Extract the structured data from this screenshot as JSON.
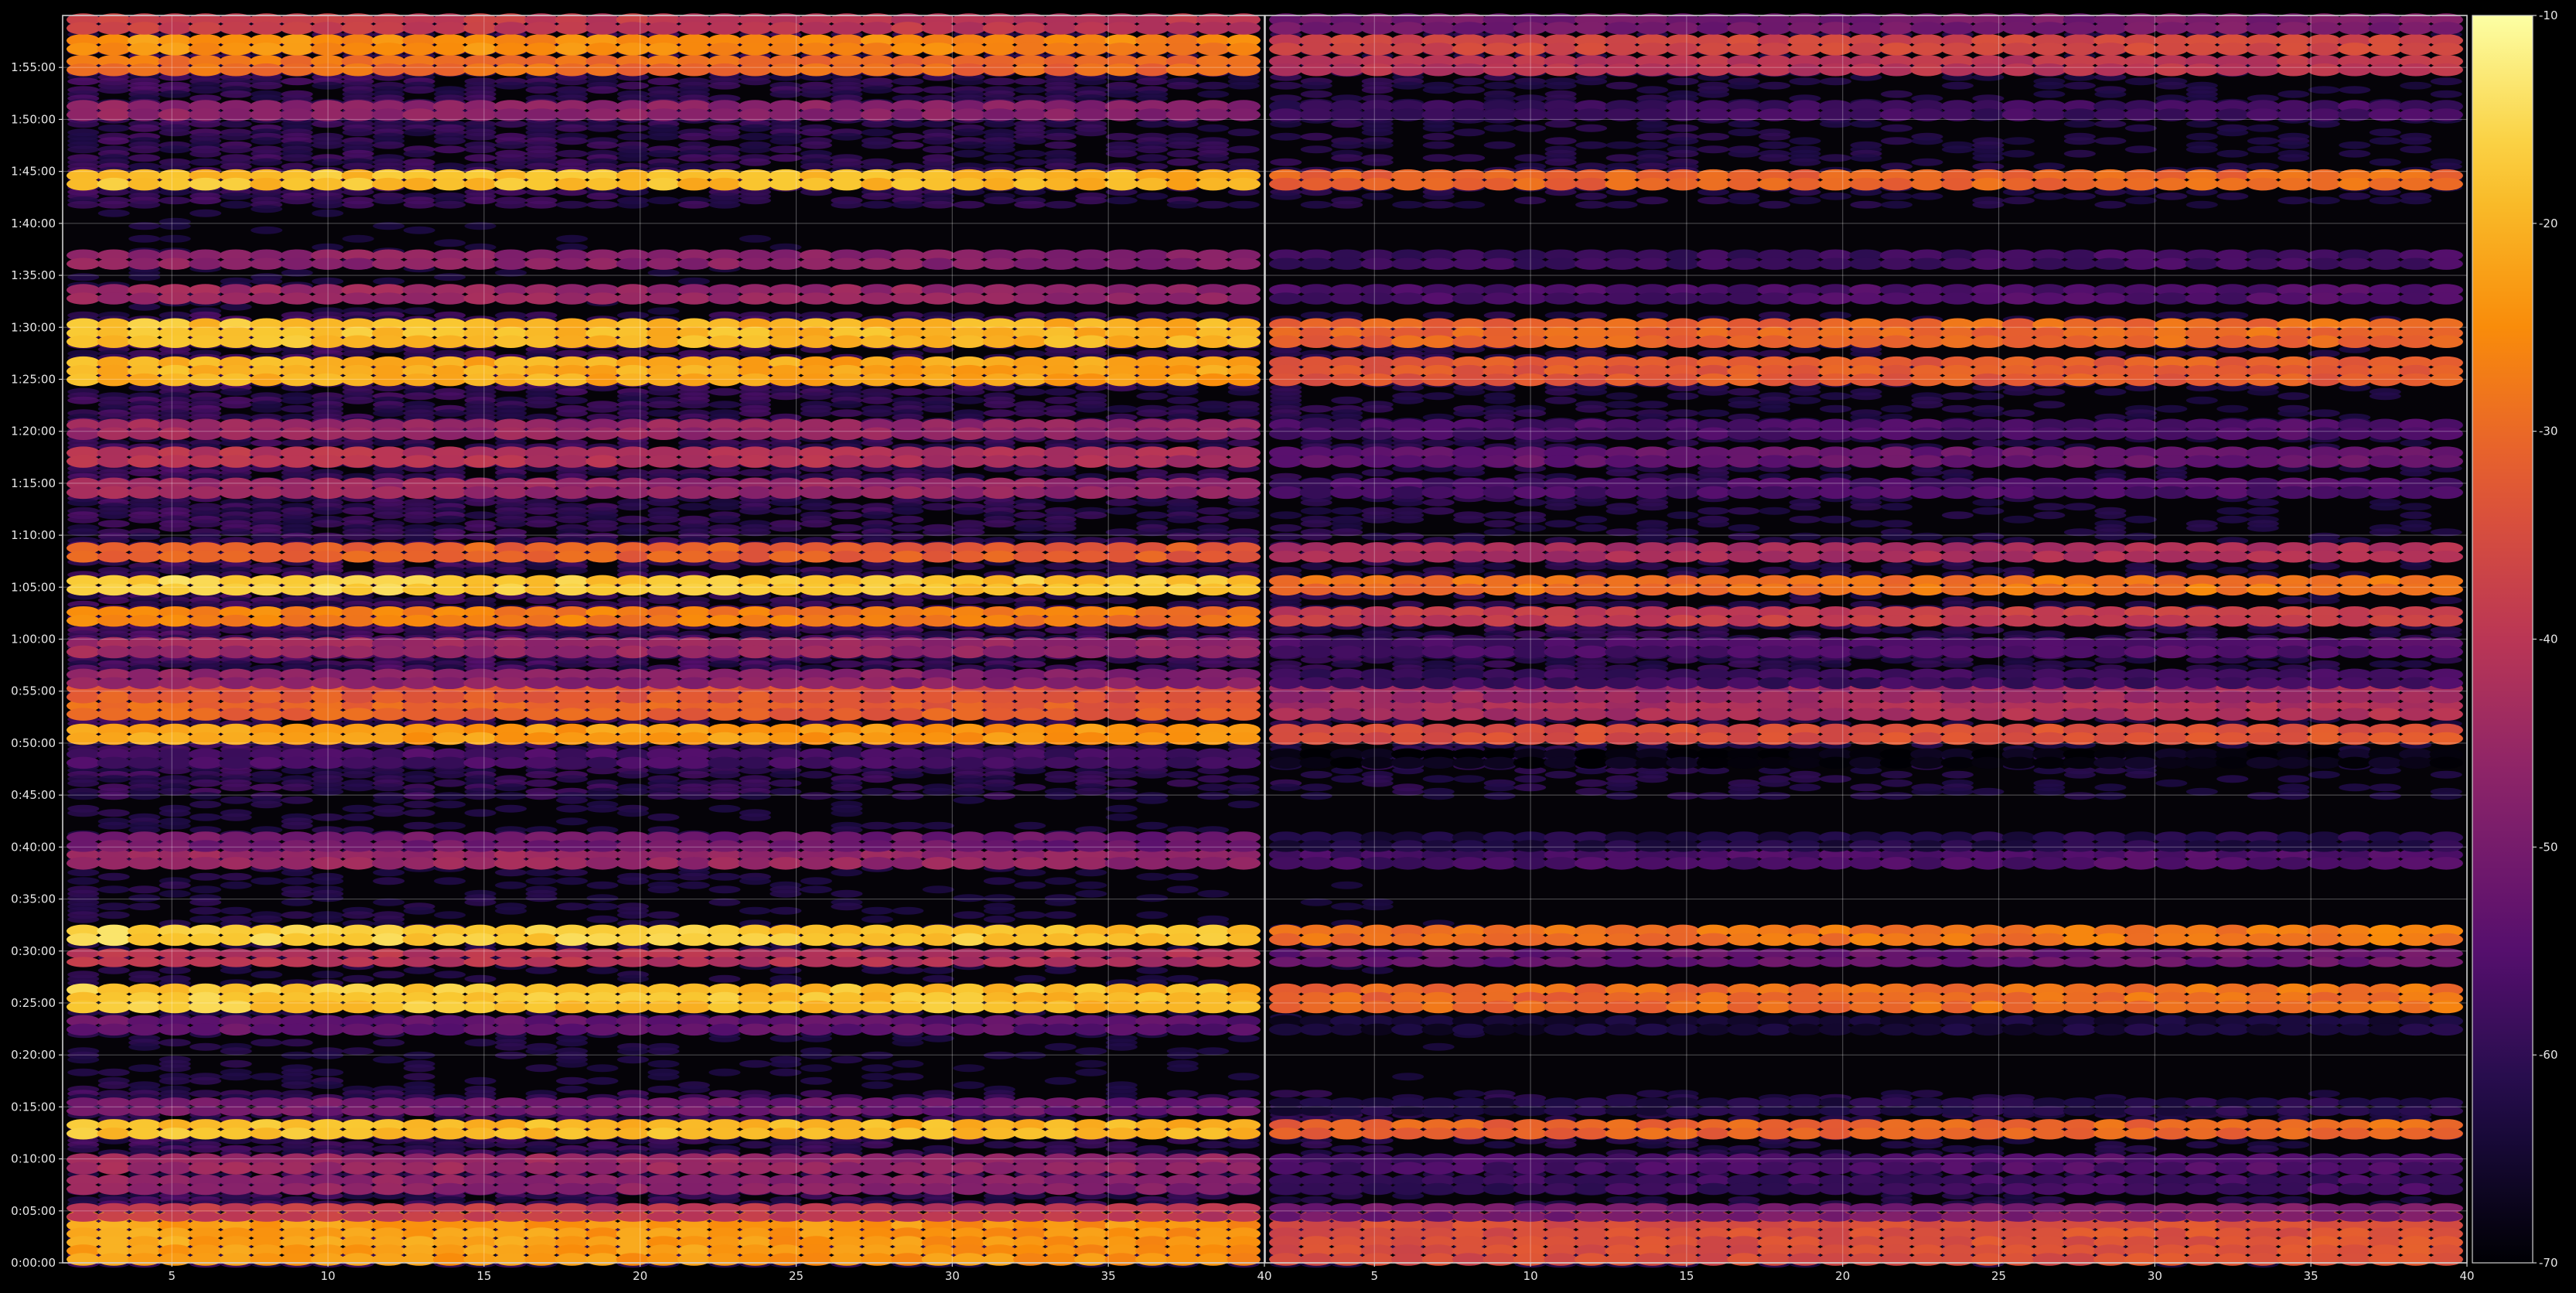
{
  "chart_data": {
    "type": "heatmap",
    "title": "",
    "xlabel": "",
    "ylabel": "",
    "panels": [
      {
        "name": "",
        "xlim": [
          1.5,
          40
        ],
        "x_ticks": [
          5,
          10,
          15,
          20,
          25,
          30,
          35,
          40
        ],
        "x_tick_labels": [
          "5",
          "10",
          "15",
          "20",
          "25",
          "30",
          "35",
          "40"
        ],
        "columns": 39,
        "level_offset": 0
      },
      {
        "name": "",
        "xlim": [
          1.5,
          40
        ],
        "x_ticks": [
          5,
          10,
          15,
          20,
          25,
          30,
          35,
          40
        ],
        "x_tick_labels": [
          "5",
          "10",
          "15",
          "20",
          "25",
          "30",
          "35",
          "40"
        ],
        "columns": 39,
        "level_offset": -11
      }
    ],
    "y_axis": {
      "unit": "seconds",
      "ylim": [
        0,
        7200
      ],
      "ticks": [
        0,
        300,
        600,
        900,
        1200,
        1500,
        1800,
        2100,
        2400,
        2700,
        3000,
        3300,
        3600,
        3900,
        4200,
        4500,
        4800,
        5100,
        5400,
        5700,
        6000,
        6300,
        6600,
        6900
      ],
      "tick_labels": [
        "0:00:00",
        "0:05:00",
        "0:10:00",
        "0:15:00",
        "0:20:00",
        "0:25:00",
        "0:30:00",
        "0:35:00",
        "0:40:00",
        "0:45:00",
        "0:50:00",
        "0:55:00",
        "1:00:00",
        "1:05:00",
        "1:10:00",
        "1:15:00",
        "1:20:00",
        "1:25:00",
        "1:30:00",
        "1:35:00",
        "1:40:00",
        "1:45:00",
        "1:50:00",
        "1:55:00"
      ]
    },
    "colorbar": {
      "colormap": "inferno",
      "range": [
        -70,
        -10
      ],
      "ticks": [
        -70,
        -60,
        -50,
        -40,
        -30,
        -20,
        -10
      ],
      "tick_labels": [
        "-70",
        "-60",
        "-50",
        "-40",
        "-30",
        "-20",
        "-10"
      ]
    },
    "bands": [
      {
        "t_start": 0,
        "t_end": 290,
        "level": -22
      },
      {
        "t_start": 290,
        "t_end": 340,
        "level": -38
      },
      {
        "t_start": 440,
        "t_end": 500,
        "level": -46
      },
      {
        "t_start": 540,
        "t_end": 620,
        "level": -44
      },
      {
        "t_start": 760,
        "t_end": 820,
        "level": -18
      },
      {
        "t_start": 900,
        "t_end": 950,
        "level": -50
      },
      {
        "t_start": 1360,
        "t_end": 1420,
        "level": -52
      },
      {
        "t_start": 1460,
        "t_end": 1600,
        "level": -17
      },
      {
        "t_start": 1760,
        "t_end": 1810,
        "level": -40
      },
      {
        "t_start": 1860,
        "t_end": 1940,
        "level": -16
      },
      {
        "t_start": 2300,
        "t_end": 2380,
        "level": -44
      },
      {
        "t_start": 2420,
        "t_end": 2480,
        "level": -50
      },
      {
        "t_start": 2900,
        "t_end": 2960,
        "level": -56
      },
      {
        "t_start": 3030,
        "t_end": 3100,
        "level": -22
      },
      {
        "t_start": 3170,
        "t_end": 3240,
        "level": -30
      },
      {
        "t_start": 3260,
        "t_end": 3340,
        "level": -32
      },
      {
        "t_start": 3360,
        "t_end": 3420,
        "level": -46
      },
      {
        "t_start": 3530,
        "t_end": 3600,
        "level": -44
      },
      {
        "t_start": 3720,
        "t_end": 3780,
        "level": -26
      },
      {
        "t_start": 3900,
        "t_end": 3960,
        "level": -16
      },
      {
        "t_start": 4090,
        "t_end": 4150,
        "level": -30
      },
      {
        "t_start": 4450,
        "t_end": 4520,
        "level": -44
      },
      {
        "t_start": 4620,
        "t_end": 4700,
        "level": -40
      },
      {
        "t_start": 4780,
        "t_end": 4860,
        "level": -44
      },
      {
        "t_start": 5100,
        "t_end": 5220,
        "level": -20
      },
      {
        "t_start": 5310,
        "t_end": 5440,
        "level": -18
      },
      {
        "t_start": 5580,
        "t_end": 5640,
        "level": -44
      },
      {
        "t_start": 5780,
        "t_end": 5840,
        "level": -46
      },
      {
        "t_start": 6210,
        "t_end": 6300,
        "level": -18
      },
      {
        "t_start": 6620,
        "t_end": 6700,
        "level": -46
      },
      {
        "t_start": 6880,
        "t_end": 6960,
        "level": -28
      },
      {
        "t_start": 7000,
        "t_end": 7080,
        "level": -24
      },
      {
        "t_start": 7110,
        "t_end": 7200,
        "level": -38
      }
    ]
  }
}
